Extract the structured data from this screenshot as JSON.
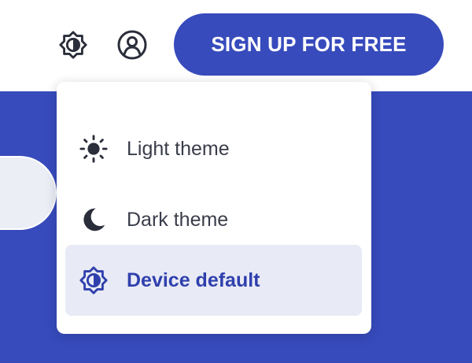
{
  "header": {
    "theme_toggle_icon": "device-theme-icon",
    "account_icon": "account-icon",
    "signup_label": "SIGN UP FOR FREE"
  },
  "theme_menu": {
    "items": [
      {
        "label": "Light theme",
        "icon": "sun-icon",
        "selected": false
      },
      {
        "label": "Dark theme",
        "icon": "moon-icon",
        "selected": false
      },
      {
        "label": "Device default",
        "icon": "device-theme-icon",
        "selected": true
      }
    ]
  },
  "colors": {
    "brand": "#374bbc",
    "selected_text": "#2f40ad",
    "selected_bg": "#e8eaf5",
    "text": "#3a3d4a"
  }
}
